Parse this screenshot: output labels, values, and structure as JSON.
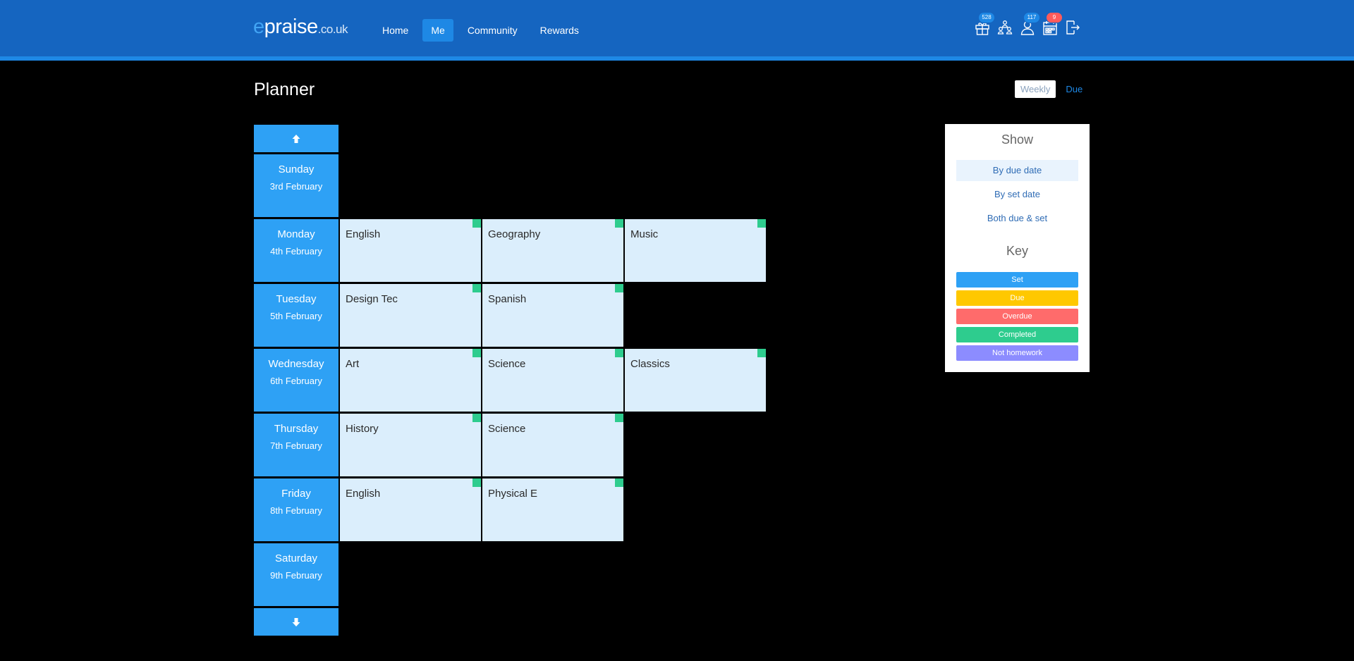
{
  "brand": {
    "e": "e",
    "rest": "praise",
    "tld": ".co.uk"
  },
  "nav": [
    {
      "label": "Home",
      "active": false
    },
    {
      "label": "Me",
      "active": true
    },
    {
      "label": "Community",
      "active": false
    },
    {
      "label": "Rewards",
      "active": false
    }
  ],
  "header_icons": [
    {
      "name": "gift-icon",
      "badge": "528",
      "badge_color": "#1e88e5"
    },
    {
      "name": "group-icon",
      "badge": "",
      "badge_color": ""
    },
    {
      "name": "user-icon",
      "badge": "117",
      "badge_color": "#1e88e5"
    },
    {
      "name": "calendar-icon",
      "badge": "9",
      "badge_color": "#ff5b5b"
    },
    {
      "name": "logout-icon",
      "badge": "",
      "badge_color": ""
    }
  ],
  "page": {
    "title": "Planner"
  },
  "view_toggle": {
    "weekly": "Weekly",
    "due": "Due"
  },
  "days": [
    {
      "name": "Sunday",
      "date": "3rd February",
      "homework": []
    },
    {
      "name": "Monday",
      "date": "4th February",
      "homework": [
        "English",
        "Geography",
        "Music"
      ]
    },
    {
      "name": "Tuesday",
      "date": "5th February",
      "homework": [
        "Design Tec",
        "Spanish"
      ]
    },
    {
      "name": "Wednesday",
      "date": "6th February",
      "homework": [
        "Art",
        "Science",
        "Classics"
      ]
    },
    {
      "name": "Thursday",
      "date": "7th February",
      "homework": [
        "History",
        "Science"
      ]
    },
    {
      "name": "Friday",
      "date": "8th February",
      "homework": [
        "English",
        "Physical E"
      ]
    },
    {
      "name": "Saturday",
      "date": "9th February",
      "homework": []
    }
  ],
  "homework_status_color": "#2ecc8e",
  "side_panel": {
    "show_title": "Show",
    "show_options": [
      "By due date",
      "By set date",
      "Both due & set"
    ],
    "key_title": "Key",
    "key": [
      {
        "label": "Set",
        "color": "#2ea1f5"
      },
      {
        "label": "Due",
        "color": "#ffc800"
      },
      {
        "label": "Overdue",
        "color": "#ff6b6b"
      },
      {
        "label": "Completed",
        "color": "#2ecc8e"
      },
      {
        "label": "Not homework",
        "color": "#8c8cff"
      }
    ]
  }
}
